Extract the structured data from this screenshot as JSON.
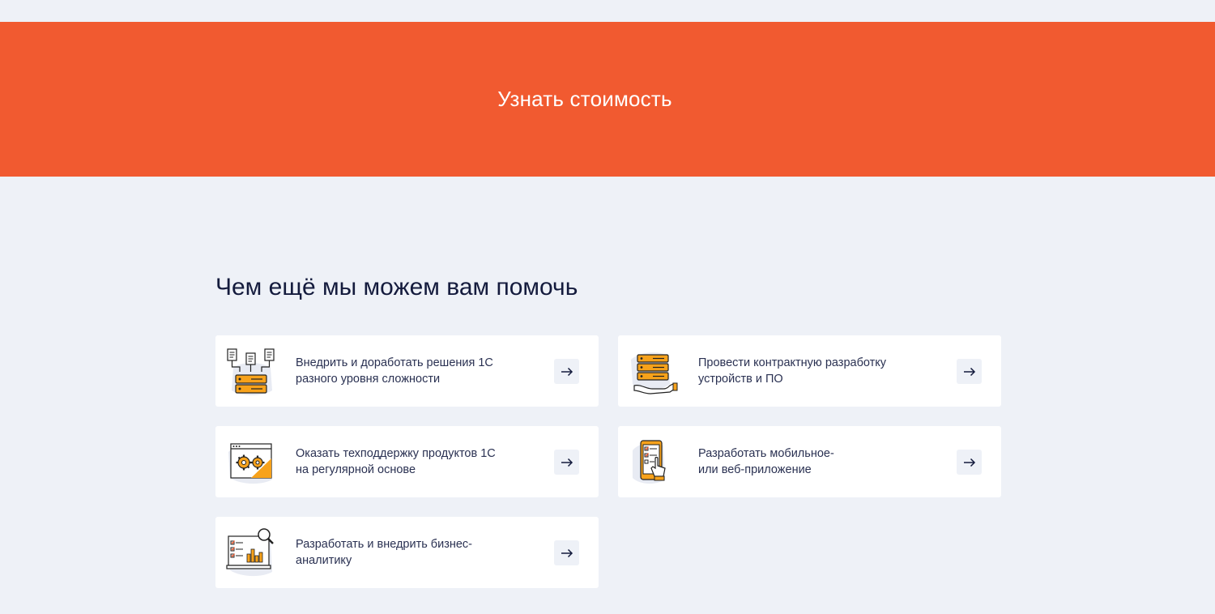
{
  "cta": {
    "label": "Узнать стоимость"
  },
  "section": {
    "title": "Чем ещё мы можем вам помочь"
  },
  "colors": {
    "accent": "#f15a30",
    "background": "#eef1f7",
    "card": "#ffffff",
    "text": "#141b3d",
    "icon_orange": "#f7a21b"
  },
  "cards": [
    {
      "text": "Внедрить и доработать решения 1С\nразного уровня сложности",
      "icon": "server-documents-icon"
    },
    {
      "text": "Провести контрактную разработку\nустройств и ПО",
      "icon": "server-hand-icon"
    },
    {
      "text": "Оказать техподдержку продуктов 1С\nна регулярной основе",
      "icon": "gears-window-icon"
    },
    {
      "text": "Разработать мобильное-\nили веб-приложение",
      "icon": "mobile-touch-icon"
    },
    {
      "text": "Разработать и внедрить бизнес-\nаналитику",
      "icon": "analytics-magnifier-icon"
    }
  ]
}
